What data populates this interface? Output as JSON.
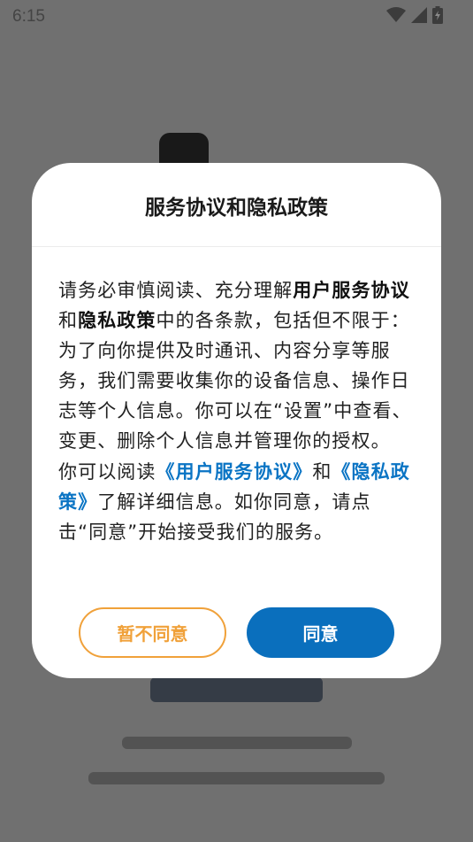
{
  "status_bar": {
    "time": "6:15",
    "icons": [
      "wifi-icon",
      "signal-icon",
      "battery-charging-icon"
    ]
  },
  "dialog": {
    "title": "服务协议和隐私政策",
    "p1": {
      "t1": "请务必审慎阅读、充分理解",
      "b1": "用户服务协议",
      "t2": "和",
      "b2": "隐私政策",
      "t3": "中的各条款，包括但不限于：为了向你提供及时通讯、内容分享等服务，我们需要收集你的设备信息、操作日志等个人信息。你可以在“设置”中查看、变更、删除个人信息并管理你的授权。"
    },
    "p2": {
      "t1": "你可以阅读",
      "link1": "《用户服务协议》",
      "t2": "和",
      "link2": "《隐私政策》",
      "t3": "了解详细信息。如你同意，请点击“同意”开始接受我们的服务。"
    },
    "disagree_label": "暂不同意",
    "agree_label": "同意"
  },
  "colors": {
    "accent_blue": "#0a6fbd",
    "link_blue": "#0a74c4",
    "accent_orange": "#f0a13a",
    "scrim": "rgba(0,0,0,0.56)"
  }
}
